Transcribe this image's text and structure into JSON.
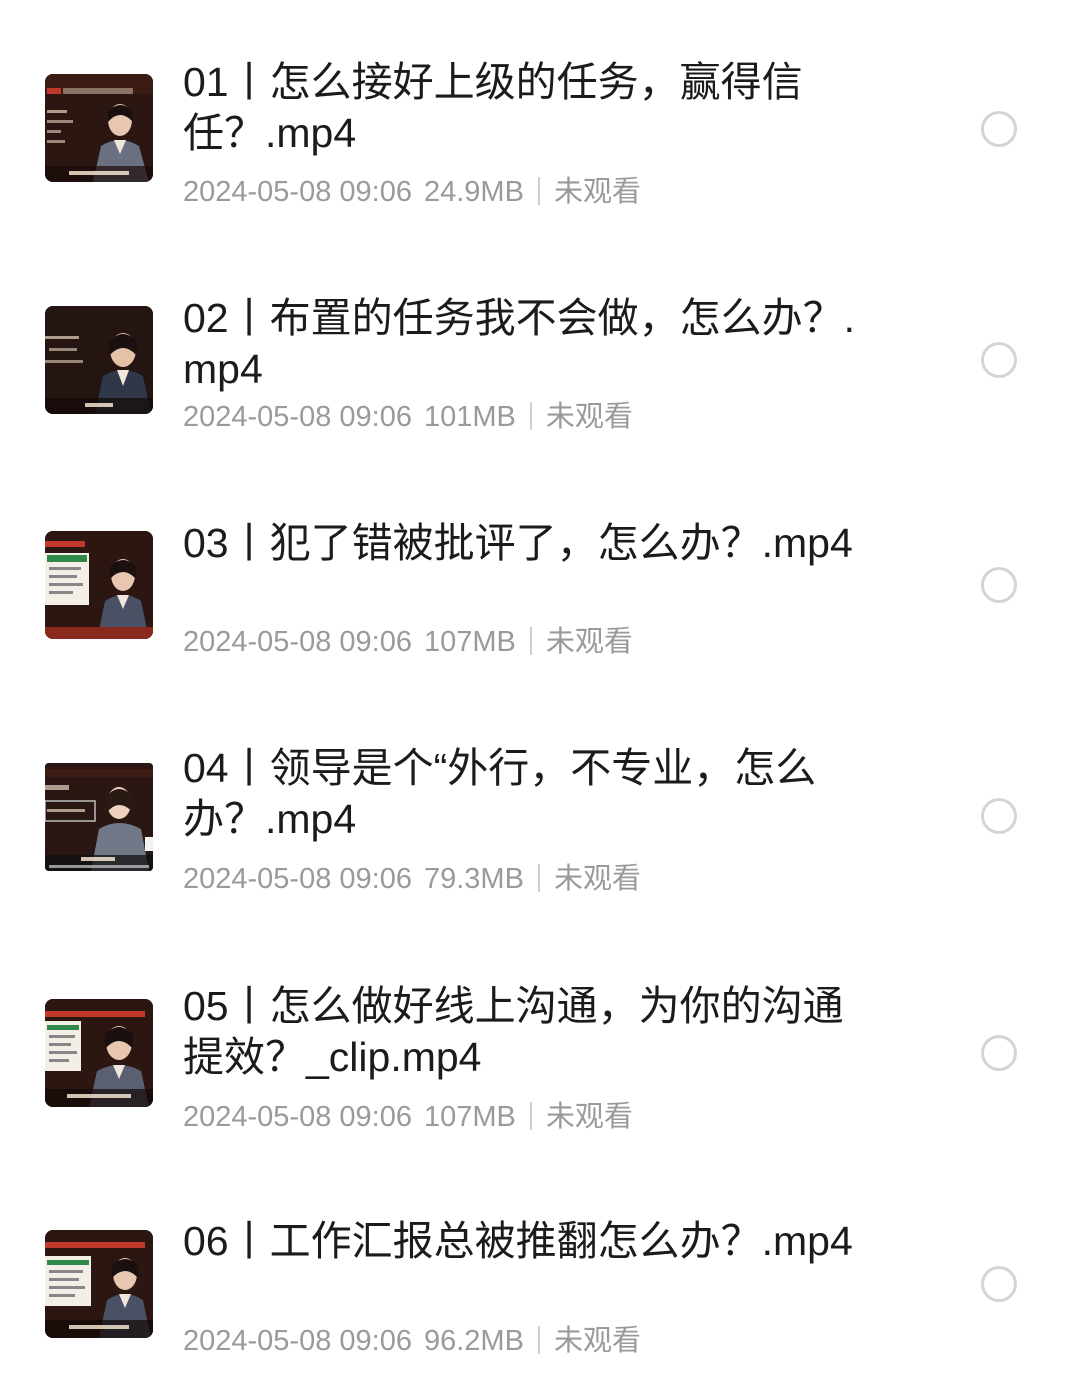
{
  "items": [
    {
      "title": "01丨怎么接好上级的任务，赢得信任？.mp4",
      "date": "2024-05-08 09:06",
      "size": "24.9MB",
      "status": "未观看",
      "thumb_caption": "最后要围绕对齐任务结果"
    },
    {
      "title": "02丨布置的任务我不会做，怎么办？.mp4",
      "date": "2024-05-08 09:06",
      "size": "101MB",
      "status": "未观看",
      "thumb_caption": "我该跟你"
    },
    {
      "title": "03丨犯了错被批评了，怎么办？.mp4",
      "date": "2024-05-08 09:06",
      "size": "107MB",
      "status": "未观看",
      "thumb_caption": ""
    },
    {
      "title": "04丨领导是个“外行，不专业，怎么办？.mp4",
      "date": "2024-05-08 09:06",
      "size": "79.3MB",
      "status": "未观看",
      "thumb_caption": "领导是了"
    },
    {
      "title": "05丨怎么做好线上沟通，为你的沟通提效？_clip.mp4",
      "date": "2024-05-08 09:06",
      "size": "107MB",
      "status": "未观看",
      "thumb_caption": "只要不满足就说下去了"
    },
    {
      "title": "06丨工作汇报总被推翻怎么办？.mp4",
      "date": "2024-05-08 09:06",
      "size": "96.2MB",
      "status": "未观看",
      "thumb_caption": "在这里我要提醒你一下"
    }
  ],
  "colors": {
    "title": "#1b1b1b",
    "meta": "#9a9a9a",
    "radio_border": "#d4d4d4",
    "thumb_bg": "#2a1410",
    "thumb_accent": "#c0392b"
  }
}
